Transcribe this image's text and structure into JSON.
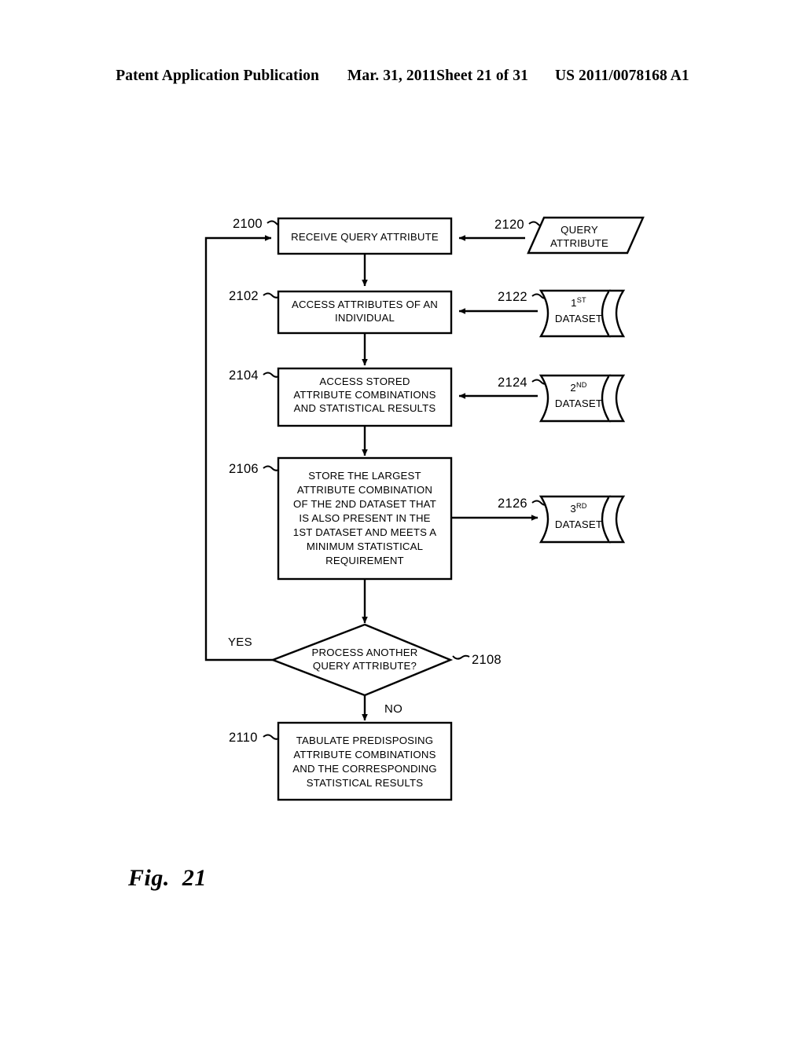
{
  "header": {
    "publication": "Patent Application Publication",
    "date": "Mar. 31, 2011",
    "sheet": "Sheet 21 of 31",
    "number": "US 2011/0078168 A1"
  },
  "figure": {
    "caption": "Fig.  21"
  },
  "flowchart": {
    "nodes": {
      "n2100": {
        "ref": "2100",
        "type": "process",
        "lines": [
          "RECEIVE QUERY ATTRIBUTE"
        ]
      },
      "n2102": {
        "ref": "2102",
        "type": "process",
        "lines": [
          "ACCESS ATTRIBUTES OF AN",
          "INDIVIDUAL"
        ]
      },
      "n2104": {
        "ref": "2104",
        "type": "process",
        "lines": [
          "ACCESS STORED",
          "ATTRIBUTE COMBINATIONS",
          "AND STATISTICAL RESULTS"
        ]
      },
      "n2106": {
        "ref": "2106",
        "type": "process",
        "lines": [
          "STORE THE LARGEST",
          "ATTRIBUTE COMBINATION",
          "OF THE 2ND DATASET THAT",
          "IS ALSO PRESENT IN THE",
          "1ST DATASET AND MEETS A",
          "MINIMUM STATISTICAL",
          "REQUIREMENT"
        ]
      },
      "n2108": {
        "ref": "2108",
        "type": "decision",
        "lines": [
          "PROCESS ANOTHER",
          "QUERY ATTRIBUTE?"
        ]
      },
      "n2110": {
        "ref": "2110",
        "type": "process",
        "lines": [
          "TABULATE PREDISPOSING",
          "ATTRIBUTE COMBINATIONS",
          "AND THE CORRESPONDING",
          "STATISTICAL RESULTS"
        ]
      },
      "n2120": {
        "ref": "2120",
        "type": "data",
        "lines": [
          "QUERY",
          "ATTRIBUTE"
        ]
      },
      "n2122": {
        "ref": "2122",
        "type": "stored-data",
        "ordinal": "1",
        "ordinal_suffix": "ST",
        "label": "DATASET"
      },
      "n2124": {
        "ref": "2124",
        "type": "stored-data",
        "ordinal": "2",
        "ordinal_suffix": "ND",
        "label": "DATASET"
      },
      "n2126": {
        "ref": "2126",
        "type": "stored-data",
        "ordinal": "3",
        "ordinal_suffix": "RD",
        "label": "DATASET"
      }
    },
    "branches": {
      "yes": "YES",
      "no": "NO"
    }
  }
}
